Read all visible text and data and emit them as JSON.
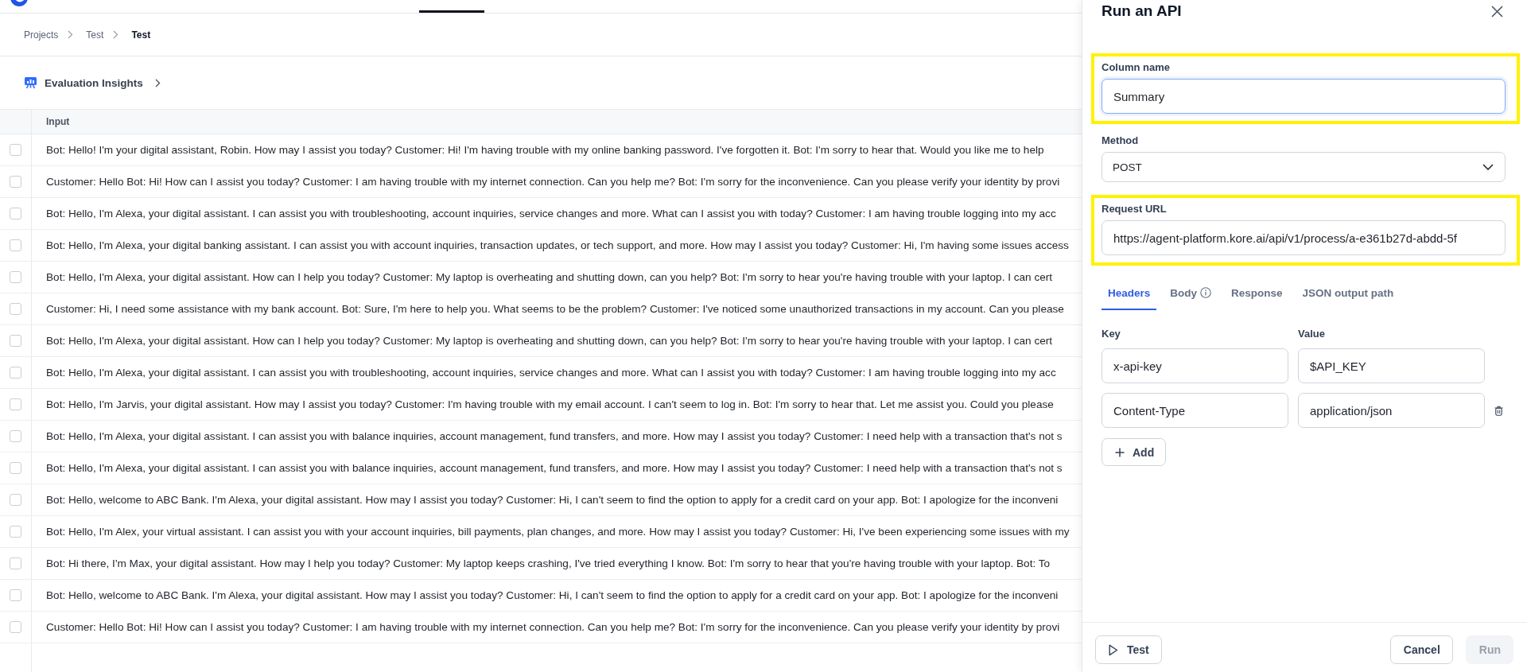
{
  "nav": {
    "tabs": [
      {
        "selected": true
      }
    ]
  },
  "breadcrumbs": [
    {
      "label": "Projects",
      "current": false
    },
    {
      "label": "Test",
      "current": false
    },
    {
      "label": "Test",
      "current": true
    }
  ],
  "section": {
    "title": "Evaluation Insights"
  },
  "table": {
    "columns": [
      "Input"
    ],
    "rows": [
      {
        "checked": false,
        "input": "Bot: Hello! I'm your digital assistant, Robin. How may I assist you today? Customer: Hi! I'm having trouble with my online banking password. I've forgotten it. Bot: I'm sorry to hear that. Would you like me to help"
      },
      {
        "checked": false,
        "input": "Customer: Hello Bot: Hi! How can I assist you today? Customer: I am having trouble with my internet connection. Can you help me? Bot: I'm sorry for the inconvenience. Can you please verify your identity by provi"
      },
      {
        "checked": false,
        "input": "Bot: Hello, I'm Alexa, your digital assistant. I can assist you with troubleshooting, account inquiries, service changes and more. What can I assist you with today? Customer: I am having trouble logging into my acc"
      },
      {
        "checked": false,
        "input": "Bot: Hello, I'm Alexa, your digital banking assistant. I can assist you with account inquiries, transaction updates, or tech support, and more. How may I assist you today? Customer: Hi, I'm having some issues access"
      },
      {
        "checked": false,
        "input": "Bot: Hello, I'm Alexa, your digital assistant. How can I help you today? Customer: My laptop is overheating and shutting down, can you help? Bot: I'm sorry to hear you're having trouble with your laptop. I can cert"
      },
      {
        "checked": false,
        "input": "Customer: Hi, I need some assistance with my bank account. Bot: Sure, I'm here to help you. What seems to be the problem? Customer: I've noticed some unauthorized transactions in my account. Can you please"
      },
      {
        "checked": false,
        "input": "Bot: Hello, I'm Alexa, your digital assistant. How can I help you today? Customer: My laptop is overheating and shutting down, can you help? Bot: I'm sorry to hear you're having trouble with your laptop. I can cert"
      },
      {
        "checked": false,
        "input": "Bot: Hello, I'm Alexa, your digital assistant. I can assist you with troubleshooting, account inquiries, service changes and more. What can I assist you with today? Customer: I am having trouble logging into my acc"
      },
      {
        "checked": false,
        "input": "Bot: Hello, I'm Jarvis, your digital assistant. How may I assist you today? Customer: I'm having trouble with my email account. I can't seem to log in. Bot: I'm sorry to hear that. Let me assist you. Could you please"
      },
      {
        "checked": false,
        "input": "Bot: Hello, I'm Alexa, your digital assistant. I can assist you with balance inquiries, account management, fund transfers, and more. How may I assist you today? Customer: I need help with a transaction that's not s"
      },
      {
        "checked": false,
        "input": "Bot: Hello, I'm Alexa, your digital assistant. I can assist you with balance inquiries, account management, fund transfers, and more. How may I assist you today? Customer: I need help with a transaction that's not s"
      },
      {
        "checked": false,
        "input": "Bot: Hello, welcome to ABC Bank. I'm Alexa, your digital assistant. How may I assist you today? Customer: Hi, I can't seem to find the option to apply for a credit card on your app. Bot: I apologize for the inconveni"
      },
      {
        "checked": false,
        "input": "Bot: Hello, I'm Alex, your virtual assistant. I can assist you with your account inquiries, bill payments, plan changes, and more. How may I assist you today? Customer: Hi, I've been experiencing some issues with my"
      },
      {
        "checked": false,
        "input": "Bot: Hi there, I'm Max, your digital assistant. How may I help you today? Customer: My laptop keeps crashing, I've tried everything I know. Bot: I'm sorry to hear that you're having trouble with your laptop. Bot: To"
      },
      {
        "checked": false,
        "input": "Bot: Hello, welcome to ABC Bank. I'm Alexa, your digital assistant. How may I assist you today? Customer: Hi, I can't seem to find the option to apply for a credit card on your app. Bot: I apologize for the inconveni"
      },
      {
        "checked": false,
        "input": "Customer: Hello Bot: Hi! How can I assist you today? Customer: I am having trouble with my internet connection. Can you help me? Bot: I'm sorry for the inconvenience. Can you please verify your identity by provi"
      }
    ]
  },
  "panel": {
    "title": "Run an API",
    "fields": [
      {
        "kind": "text",
        "label": "Column name",
        "value": "Summary",
        "focused": true,
        "highlighted": true
      },
      {
        "kind": "select",
        "label": "Method",
        "value": "POST",
        "focused": false,
        "highlighted": false
      },
      {
        "kind": "text",
        "label": "Request URL",
        "value": "https://agent-platform.kore.ai/api/v1/process/a-e361b27d-abdd-5f",
        "focused": false,
        "highlighted": true
      }
    ],
    "tabs": [
      {
        "label": "Headers",
        "selected": true,
        "info": false
      },
      {
        "label": "Body",
        "selected": false,
        "info": true
      },
      {
        "label": "Response",
        "selected": false,
        "info": false
      },
      {
        "label": "JSON output path",
        "selected": false,
        "info": false
      }
    ],
    "headers": {
      "key_label": "Key",
      "value_label": "Value",
      "rows": [
        {
          "key": "x-api-key",
          "value": "$API_KEY",
          "removable": false
        },
        {
          "key": "Content-Type",
          "value": "application/json",
          "removable": true
        }
      ],
      "add_button": "Add"
    },
    "footer": {
      "test_button": "Test",
      "cancel_button": "Cancel",
      "run_button": {
        "label": "Run",
        "disabled": true
      }
    }
  }
}
